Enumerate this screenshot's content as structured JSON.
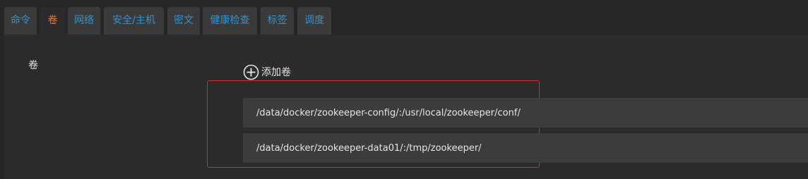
{
  "tabs": [
    {
      "label": "命令"
    },
    {
      "label": "卷",
      "active": true
    },
    {
      "label": "网络"
    },
    {
      "label": "安全/主机"
    },
    {
      "label": "密文"
    },
    {
      "label": "健康检查"
    },
    {
      "label": "标签"
    },
    {
      "label": "调度"
    }
  ],
  "volumes_section": {
    "label": "卷",
    "add_label": "添加卷",
    "items": [
      {
        "value": "/data/docker/zookeeper-config/:/usr/local/zookeeper/conf/"
      },
      {
        "value": "/data/docker/zookeeper-data01/:/tmp/zookeeper/"
      }
    ]
  },
  "colors": {
    "tab_text": "#3392cc",
    "tab_active_text": "#e8793a",
    "highlight_border": "#d32c2c"
  }
}
